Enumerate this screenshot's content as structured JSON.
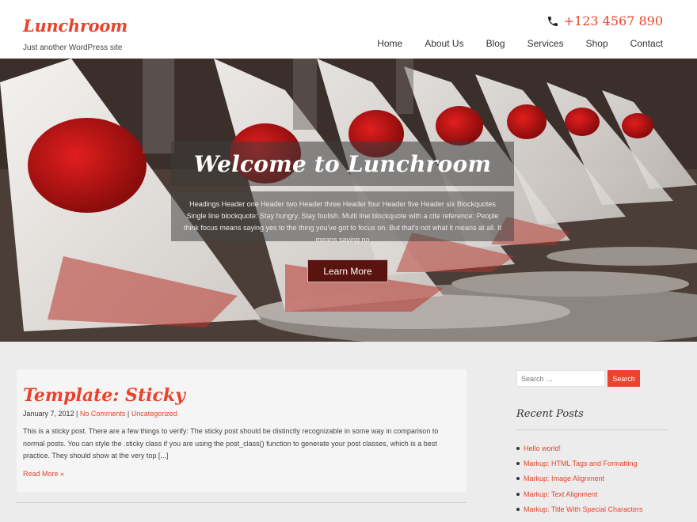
{
  "site": {
    "title": "Lunchroom",
    "tagline": "Just another WordPress site",
    "phone": "+123 4567 890",
    "phone_icon": "phone-icon"
  },
  "nav": {
    "items": [
      {
        "label": "Home"
      },
      {
        "label": "About Us"
      },
      {
        "label": "Blog"
      },
      {
        "label": "Services"
      },
      {
        "label": "Shop"
      },
      {
        "label": "Contact"
      }
    ]
  },
  "hero": {
    "title": "Welcome to Lunchroom",
    "text": "Headings Header one Header two Header three Header four Header five Header six Blockquotes Single line blockquote: Stay hungry. Stay foolish. Multi line blockquote with a cite reference: People think focus means saying yes to the thing you've got to focus on. But that's not what it means at all. It means saying no",
    "button_label": "Learn More"
  },
  "post": {
    "title": "Template: Sticky",
    "date": "January 7, 2012",
    "sep1": " | ",
    "comments": "No Comments",
    "sep2": " | ",
    "category": "Uncategorized",
    "excerpt": "This is a sticky post. There are a few things to verify: The sticky post should be distinctly recognizable in some way in comparison to normal posts. You can style the .sticky class if you are using the post_class() function to generate your post classes, which is a best practice. They should show at the very top [...]",
    "read_more": "Read More »"
  },
  "sidebar": {
    "search_placeholder": "Search …",
    "search_button": "Search",
    "recent_title": "Recent Posts",
    "recent_posts": [
      {
        "label": "Hello world!"
      },
      {
        "label": "Markup: HTML Tags and Formatting"
      },
      {
        "label": "Markup: Image Alignment"
      },
      {
        "label": "Markup: Text Alignment"
      },
      {
        "label": "Markup: Title With Special Characters"
      }
    ]
  },
  "colors": {
    "accent": "#e8432c",
    "button_dark": "#5a1410",
    "background": "#ececec"
  }
}
